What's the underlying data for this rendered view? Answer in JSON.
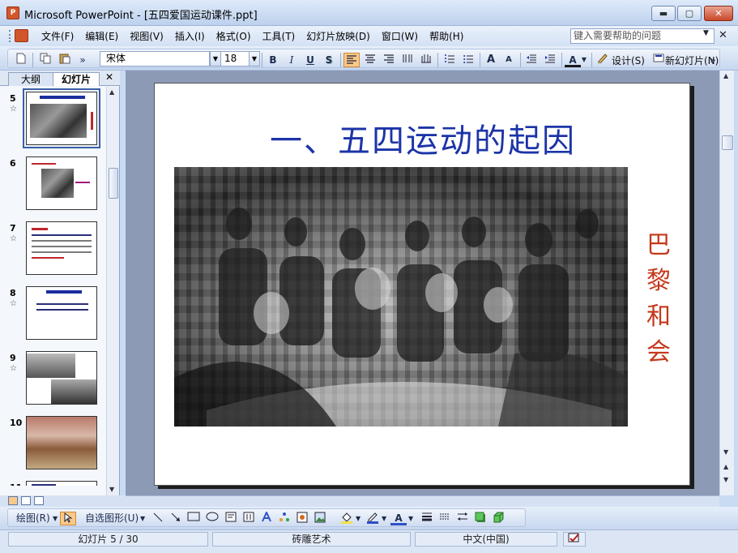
{
  "window": {
    "title": "Microsoft PowerPoint - [五四爱国运动课件.ppt]",
    "app_icon": "powerpoint-icon",
    "min_glyph": "▬",
    "max_glyph": "▢",
    "close_glyph": "✕"
  },
  "menu": {
    "items": [
      "文件(F)",
      "编辑(E)",
      "视图(V)",
      "插入(I)",
      "格式(O)",
      "工具(T)",
      "幻灯片放映(D)",
      "窗口(W)",
      "帮助(H)"
    ],
    "help_placeholder": "键入需要帮助的问题",
    "help_dropdown": "▼",
    "doc_close": "✕"
  },
  "toolbar": {
    "font": "宋体",
    "size": "18",
    "bold": "B",
    "italic": "I",
    "underline": "U",
    "shadow": "S",
    "font_color": "A",
    "grow": "A",
    "shrink": "A",
    "design": "设计(S)",
    "new_slide": "新幻灯片(N)",
    "overflow": "»",
    "dropdown": "▼"
  },
  "pane": {
    "tabs": [
      "大纲",
      "幻灯片"
    ],
    "close": "✕",
    "slides": [
      {
        "num": "5",
        "star": "☆",
        "selected": true
      },
      {
        "num": "6",
        "star": "",
        "selected": false
      },
      {
        "num": "7",
        "star": "☆",
        "selected": false
      },
      {
        "num": "8",
        "star": "☆",
        "selected": false
      },
      {
        "num": "9",
        "star": "☆",
        "selected": false
      },
      {
        "num": "10",
        "star": "",
        "selected": false
      },
      {
        "num": "11",
        "star": "",
        "selected": false
      }
    ],
    "scroll_up": "▲",
    "scroll_down": "▼"
  },
  "slide": {
    "title": "一、五四运动的起因",
    "caption_chars": [
      "巴",
      "黎",
      "和",
      "会"
    ],
    "title_color": "#1c34a8",
    "caption_color": "#c4381b"
  },
  "right_scroll": {
    "up": "▲",
    "down": "▼",
    "prev": "▲",
    "next": "▼"
  },
  "drawing": {
    "draw": "绘图(R)",
    "autoshapes": "自选图形(U)",
    "font_color": "A"
  },
  "status": {
    "slide": "幻灯片 5 / 30",
    "design": "砖雕艺术",
    "language": "中文(中国)"
  }
}
